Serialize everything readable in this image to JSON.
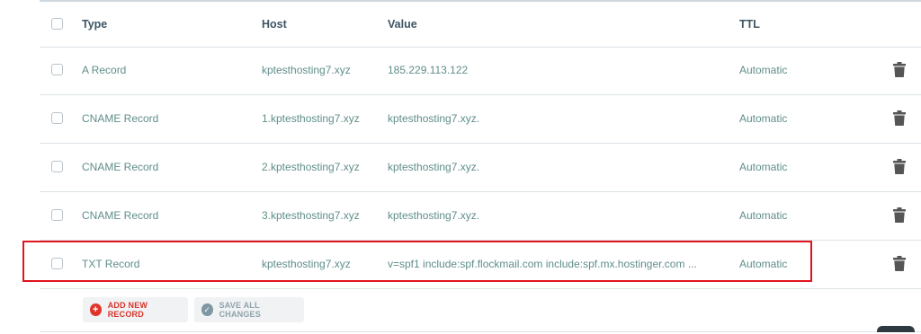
{
  "table": {
    "headers": {
      "type": "Type",
      "host": "Host",
      "value": "Value",
      "ttl": "TTL"
    },
    "rows": [
      {
        "type": "A Record",
        "host": "kptesthosting7.xyz",
        "value": "185.229.113.122",
        "ttl": "Automatic"
      },
      {
        "type": "CNAME Record",
        "host": "1.kptesthosting7.xyz",
        "value": "kptesthosting7.xyz.",
        "ttl": "Automatic"
      },
      {
        "type": "CNAME Record",
        "host": "2.kptesthosting7.xyz",
        "value": "kptesthosting7.xyz.",
        "ttl": "Automatic"
      },
      {
        "type": "CNAME Record",
        "host": "3.kptesthosting7.xyz",
        "value": "kptesthosting7.xyz.",
        "ttl": "Automatic"
      },
      {
        "type": "TXT Record",
        "host": "kptesthosting7.xyz",
        "value": "v=spf1 include:spf.flockmail.com include:spf.mx.hostinger.com ...",
        "ttl": "Automatic"
      }
    ]
  },
  "actions": {
    "add_label": "ADD NEW RECORD",
    "save_label": "SAVE ALL CHANGES"
  },
  "colors": {
    "highlight": "#e0141e",
    "accent_add": "#e0352a",
    "text_teal": "#5f8e8a"
  },
  "icons": {
    "delete": "trash-icon",
    "add": "plus-circle-icon",
    "save": "check-circle-icon"
  }
}
